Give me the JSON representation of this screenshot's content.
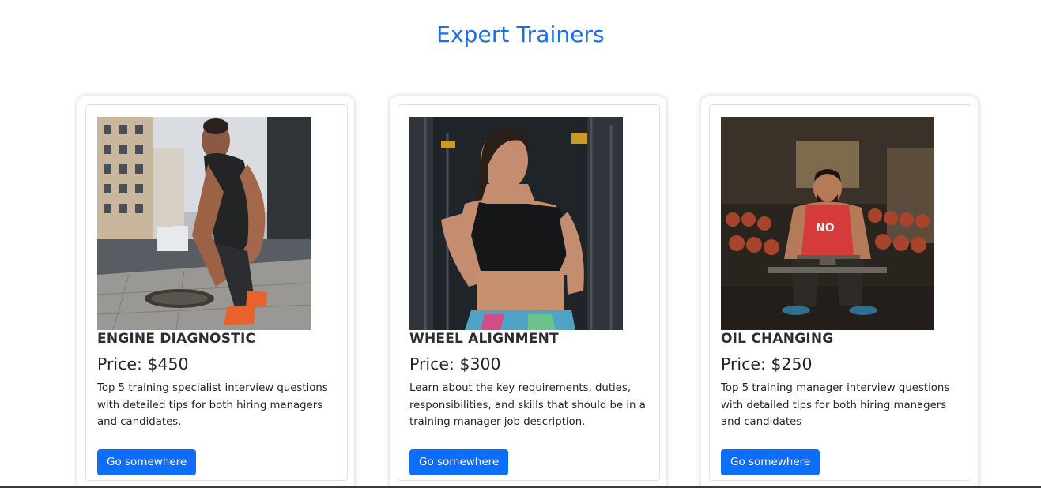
{
  "header": {
    "title": "Expert Trainers"
  },
  "colors": {
    "title": "#1a6fe8",
    "button": "#0d6efd"
  },
  "cards": [
    {
      "image": "trainer-tying-shoe-photo",
      "title": "ENGINE DIAGNOSTIC",
      "price": "Price: $450",
      "description": "Top 5 training specialist interview questions with detailed tips for both hiring managers and candidates.",
      "button": "Go somewhere"
    },
    {
      "image": "trainer-woman-gym-photo",
      "title": "WHEEL ALIGNMENT",
      "price": "Price: $300",
      "description": "Learn about the key requirements, duties, responsibilities, and skills that should be in a training manager job description.",
      "button": "Go somewhere"
    },
    {
      "image": "trainer-man-seated-gym-photo",
      "title": "OIL CHANGING",
      "price": "Price: $250",
      "description": "Top 5 training manager interview questions with detailed tips for both hiring managers and candidates",
      "button": "Go somewhere"
    }
  ]
}
